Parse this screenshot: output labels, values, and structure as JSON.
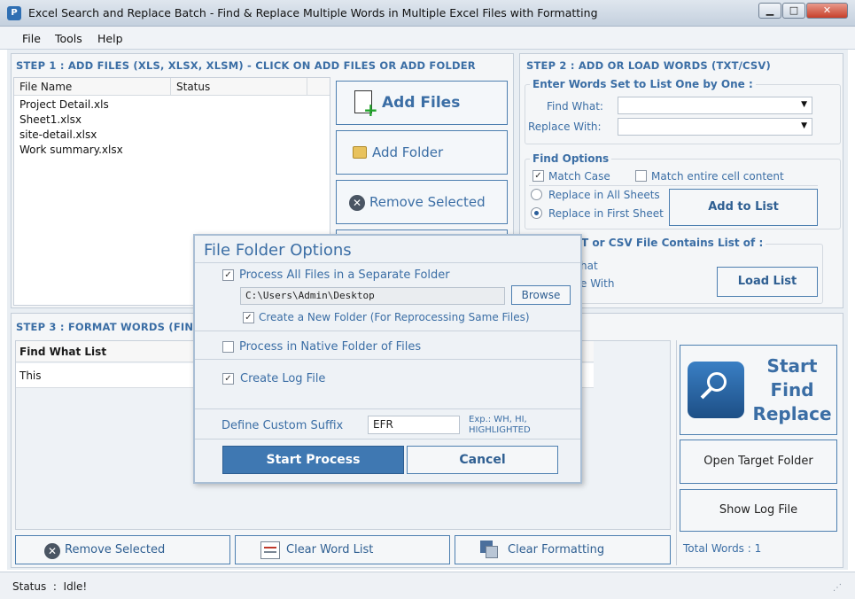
{
  "window": {
    "title": "Excel Search and Replace Batch - Find & Replace Multiple Words in Multiple Excel Files with Formatting",
    "min": "▁",
    "max": "□",
    "close": "✕",
    "icon": "app-icon"
  },
  "menu": [
    "File",
    "Tools",
    "Help"
  ],
  "step1": {
    "title": "STEP 1 : ADD FILES (XLS, XLSX, XLSM) - CLICK ON ADD FILES OR ADD FOLDER",
    "columns": [
      "File Name",
      "Status"
    ],
    "files": [
      "Project Detail.xls",
      "Sheet1.xlsx",
      "site-detail.xlsx",
      "Work summary.xlsx"
    ],
    "add_files": "Add Files",
    "add_folder": "Add Folder",
    "remove_selected": "Remove Selected"
  },
  "step2": {
    "title": "STEP 2 : ADD OR LOAD WORDS (TXT/CSV)",
    "enter_group": "Enter Words Set to List One by One :",
    "find_what_label": "Find What:",
    "replace_with_label": "Replace With:",
    "find_options_group": "Find Options",
    "match_case": "Match Case",
    "match_entire": "Match entire cell content",
    "replace_all_sheets": "Replace in All Sheets",
    "replace_first_sheet": "Replace in First Sheet",
    "add_to_list": "Add to List",
    "load_group_partial": "T or CSV File Contains List of :",
    "load_line1": "hat",
    "load_line2": "e With",
    "load_list": "Load List"
  },
  "step3": {
    "title": "STEP 3 : FORMAT WORDS (FIND",
    "column": "Find What List",
    "rows": [
      "This"
    ],
    "remove_selected": "Remove Selected",
    "clear_word_list": "Clear Word List",
    "clear_formatting": "Clear Formatting"
  },
  "right": {
    "start_lines": [
      "Start",
      "Find",
      "Replace"
    ],
    "open_target": "Open Target Folder",
    "show_log": "Show Log File",
    "total_words": "Total Words : 1"
  },
  "dialog": {
    "title": "File Folder Options",
    "process_separate": "Process All Files in a Separate Folder",
    "folder_path": "C:\\Users\\Admin\\Desktop",
    "browse": "Browse",
    "create_new_folder": "Create a New Folder (For Reprocessing Same Files)",
    "process_native": "Process in Native Folder of Files",
    "create_log": "Create Log File",
    "suffix_label": "Define Custom Suffix",
    "suffix_value": "EFR",
    "suffix_hint_1": "Exp.: WH, HI,",
    "suffix_hint_2": "HIGHLIGHTED",
    "start_process": "Start Process",
    "cancel": "Cancel"
  },
  "status": {
    "text": "Status  :  Idle!"
  },
  "colors": {
    "accent": "#3b6ea5",
    "primary_button": "#3f78b2"
  }
}
